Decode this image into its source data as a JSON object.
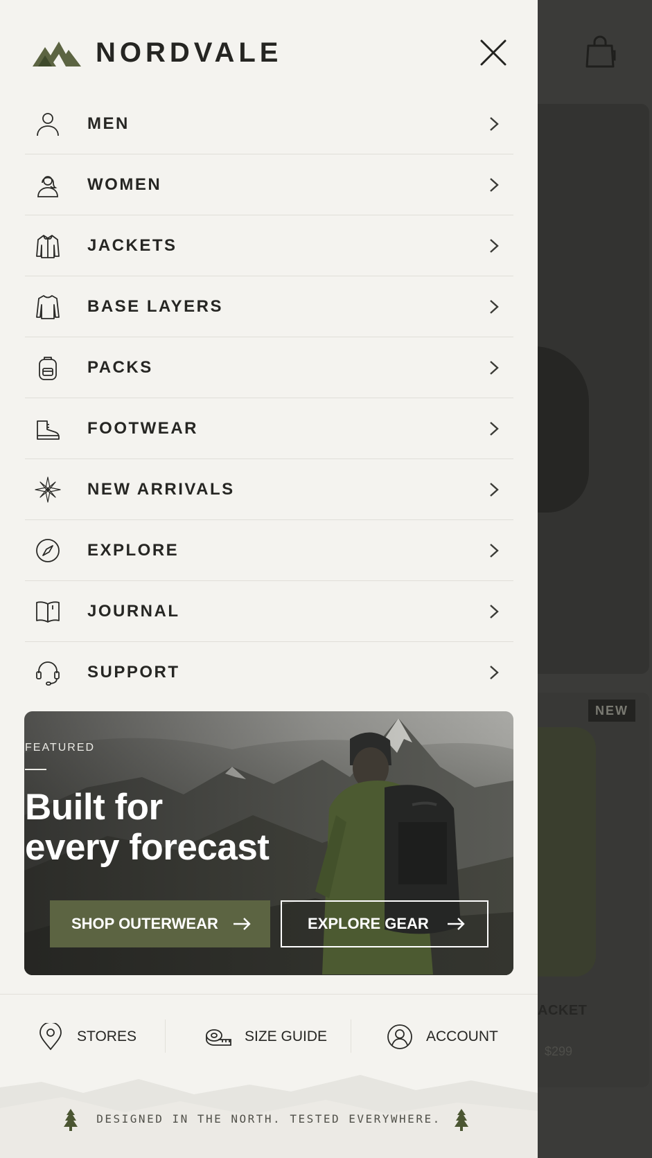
{
  "brand": {
    "name": "NORDVALE"
  },
  "menu": {
    "items": [
      {
        "label": "MEN",
        "icon": "person-icon"
      },
      {
        "label": "WOMEN",
        "icon": "person-woman-icon"
      },
      {
        "label": "JACKETS",
        "icon": "jacket-icon"
      },
      {
        "label": "BASE LAYERS",
        "icon": "long-sleeve-shirt-icon"
      },
      {
        "label": "PACKS",
        "icon": "backpack-icon"
      },
      {
        "label": "FOOTWEAR",
        "icon": "boot-icon"
      },
      {
        "label": "NEW ARRIVALS",
        "icon": "compass-star-icon"
      },
      {
        "label": "EXPLORE",
        "icon": "compass-icon"
      },
      {
        "label": "JOURNAL",
        "icon": "book-icon"
      },
      {
        "label": "SUPPORT",
        "icon": "headset-icon"
      }
    ]
  },
  "featured": {
    "kicker": "FEATURED",
    "title_line1": "Built for",
    "title_line2": "every forecast",
    "primary_cta": "SHOP OUTERWEAR",
    "secondary_cta": "EXPLORE GEAR"
  },
  "utility": {
    "stores": "STORES",
    "size_guide": "SIZE GUIDE",
    "account": "ACCOUNT"
  },
  "footer": {
    "tagline": "DESIGNED IN THE NORTH. TESTED EVERYWHERE."
  },
  "background": {
    "badge": "NEW",
    "product_name_fragment": "ACKET",
    "price": "$299"
  },
  "colors": {
    "drawer_bg": "#f4f3ef",
    "text": "#262623",
    "accent_olive": "#5c6442",
    "overlay": "#3b3b39"
  }
}
